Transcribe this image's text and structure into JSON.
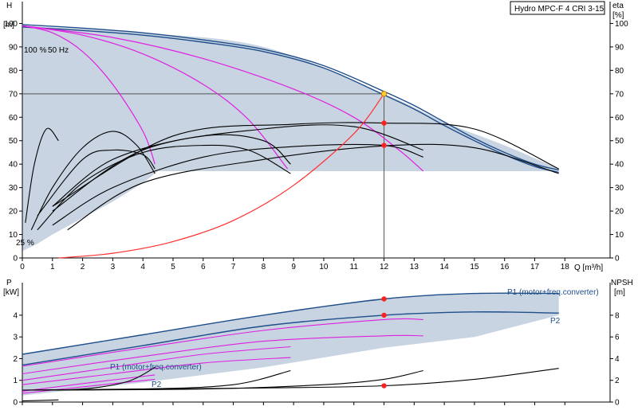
{
  "title": "Hydro MPC-F 4 CRI 3-15",
  "colors": {
    "envelope": "#c8d4e2",
    "curve_blue": "#1f4e8a",
    "curve_magenta": "#e020e0",
    "curve_black": "#000000",
    "system_curve": "#ff3030",
    "duty_point": "#ff2020",
    "duty_point_top": "#ffcc33",
    "grid_line": "#555555"
  },
  "top": {
    "y_left_label": "H",
    "y_left_unit": "[m]",
    "y_right_label": "eta",
    "y_right_unit": "[%]",
    "x_label": "Q [m³/h]",
    "annotation_speed": "100 %",
    "annotation_freq": "50 Hz",
    "annotation_min": "25 %"
  },
  "bottom": {
    "y_left_label": "P",
    "y_left_unit": "[kW]",
    "y_right_label": "NPSH",
    "y_right_unit": "[m]",
    "label_p1_upper": "P1 (motor+freq.converter)",
    "label_p2_upper": "P2",
    "label_p1_lower": "P1 (motor+freq.converter)",
    "label_p2_lower": "P2"
  },
  "chart_data": [
    {
      "type": "line",
      "title": "Hydro MPC-F 4 CRI 3-15",
      "xlabel": "Q [m³/h]",
      "ylabel": "H [m]",
      "y2label": "eta [%]",
      "xlim": [
        0,
        19.5
      ],
      "ylim": [
        0,
        110
      ],
      "xticks": [
        0,
        1,
        2,
        3,
        4,
        5,
        6,
        7,
        8,
        9,
        10,
        11,
        12,
        13,
        14,
        15,
        16,
        17,
        18
      ],
      "yticks": [
        0,
        10,
        20,
        30,
        40,
        50,
        60,
        70,
        80,
        90,
        100
      ],
      "grid": false,
      "envelope": {
        "upper": [
          [
            0,
            99
          ],
          [
            4,
            96
          ],
          [
            8,
            90
          ],
          [
            12,
            70
          ],
          [
            14,
            58
          ],
          [
            16,
            48
          ],
          [
            17.8,
            38
          ]
        ],
        "lower_x_from": 4.5,
        "lower_y": 37,
        "left_min_curve": [
          [
            0,
            3
          ],
          [
            0.5,
            6
          ],
          [
            1,
            10
          ],
          [
            2,
            17
          ],
          [
            3,
            24
          ],
          [
            4,
            32
          ],
          [
            4.5,
            37
          ]
        ]
      },
      "series": [
        {
          "kind": "head",
          "color": "blue",
          "values": [
            [
              0,
              99.5
            ],
            [
              2,
              98
            ],
            [
              4,
              96
            ],
            [
              6,
              93
            ],
            [
              8,
              89
            ],
            [
              10,
              82
            ],
            [
              12,
              71
            ],
            [
              13,
              65
            ],
            [
              14,
              58
            ],
            [
              15,
              51
            ],
            [
              16,
              45
            ],
            [
              17,
              40
            ],
            [
              17.8,
              37.5
            ]
          ]
        },
        {
          "kind": "head",
          "color": "blue",
          "values": [
            [
              0,
              98.5
            ],
            [
              2,
              97
            ],
            [
              4,
              95
            ],
            [
              6,
              92
            ],
            [
              8,
              88
            ],
            [
              10,
              81
            ],
            [
              12,
              69.5
            ],
            [
              13,
              63.5
            ],
            [
              14,
              56.5
            ],
            [
              15,
              50
            ],
            [
              16,
              44
            ],
            [
              17,
              39
            ],
            [
              17.8,
              36.5
            ]
          ]
        },
        {
          "kind": "head",
          "color": "magenta",
          "values": [
            [
              0,
              99
            ],
            [
              1,
              96
            ],
            [
              2,
              88
            ],
            [
              3,
              74
            ],
            [
              4,
              54
            ],
            [
              4.4,
              40
            ]
          ]
        },
        {
          "kind": "head",
          "color": "magenta",
          "values": [
            [
              0,
              99
            ],
            [
              2,
              95
            ],
            [
              4,
              87
            ],
            [
              6,
              74
            ],
            [
              7.5,
              59
            ],
            [
              8.8,
              38
            ]
          ]
        },
        {
          "kind": "head",
          "color": "magenta",
          "values": [
            [
              0,
              99
            ],
            [
              3,
              94
            ],
            [
              6,
              85
            ],
            [
              9,
              72
            ],
            [
              11,
              60
            ],
            [
              12.5,
              46
            ],
            [
              13.3,
              37
            ]
          ]
        },
        {
          "kind": "efficiency",
          "color": "black",
          "values": [
            [
              0.1,
              15
            ],
            [
              0.4,
              40
            ],
            [
              0.8,
              55
            ],
            [
              1.2,
              50
            ]
          ]
        },
        {
          "kind": "efficiency",
          "color": "black",
          "values": [
            [
              0.3,
              12
            ],
            [
              1,
              30
            ],
            [
              2,
              47
            ],
            [
              3,
              54
            ],
            [
              3.8,
              48
            ],
            [
              4.4,
              36
            ]
          ]
        },
        {
          "kind": "efficiency",
          "color": "black",
          "values": [
            [
              0.5,
              12
            ],
            [
              2,
              32
            ],
            [
              4,
              45
            ],
            [
              6,
              48
            ],
            [
              7.5,
              46
            ],
            [
              8.9,
              36
            ]
          ]
        },
        {
          "kind": "efficiency",
          "color": "black",
          "values": [
            [
              1,
              14
            ],
            [
              3,
              30
            ],
            [
              6,
              43
            ],
            [
              9,
              47.5
            ],
            [
              12,
              48
            ],
            [
              13.3,
              43
            ]
          ]
        },
        {
          "kind": "efficiency",
          "color": "black",
          "values": [
            [
              1.5,
              12
            ],
            [
              4,
              32
            ],
            [
              8,
              42
            ],
            [
              12,
              47.8
            ],
            [
              15,
              47
            ],
            [
              17.8,
              36
            ]
          ]
        },
        {
          "kind": "efficiency",
          "color": "black",
          "values": [
            [
              0.5,
              18
            ],
            [
              2,
              42
            ],
            [
              3,
              46
            ],
            [
              4,
              44
            ],
            [
              4.4,
              38
            ]
          ]
        },
        {
          "kind": "efficiency",
          "color": "black",
          "values": [
            [
              1,
              22
            ],
            [
              3,
              42
            ],
            [
              6,
              52
            ],
            [
              8,
              50
            ],
            [
              8.9,
              40
            ]
          ]
        },
        {
          "kind": "efficiency",
          "color": "black",
          "values": [
            [
              1,
              20
            ],
            [
              4,
              46
            ],
            [
              8,
              55
            ],
            [
              11,
              56
            ],
            [
              13.3,
              46
            ]
          ]
        },
        {
          "kind": "efficiency",
          "color": "black",
          "values": [
            [
              1,
              22
            ],
            [
              5,
              52
            ],
            [
              9,
              57
            ],
            [
              12,
              57.5
            ],
            [
              15,
              55
            ],
            [
              17.8,
              38
            ]
          ]
        },
        {
          "kind": "system",
          "color": "red",
          "values": [
            [
              1.2,
              0
            ],
            [
              3,
              2
            ],
            [
              5,
              7
            ],
            [
              7,
              16
            ],
            [
              9,
              31
            ],
            [
              11,
              53
            ],
            [
              12,
              70
            ]
          ]
        }
      ],
      "duty_points": [
        {
          "x": 12,
          "y": 70,
          "kind": "head"
        },
        {
          "x": 12,
          "y": 57.5,
          "kind": "eta_total"
        },
        {
          "x": 12,
          "y": 48,
          "kind": "eta"
        }
      ]
    },
    {
      "type": "line",
      "xlabel": "Q [m³/h]",
      "ylabel": "P [kW]",
      "y2label": "NPSH [m]",
      "xlim": [
        0,
        19.5
      ],
      "ylim": [
        0,
        5.5
      ],
      "yticks": [
        0,
        1,
        2,
        3,
        4
      ],
      "y2ticks": [
        0,
        2,
        4,
        6,
        8
      ],
      "series": [
        {
          "name": "P1 (motor+freq.converter)",
          "kind": "power",
          "color": "blue",
          "values": [
            [
              0,
              2.2
            ],
            [
              4,
              3.1
            ],
            [
              8,
              4.0
            ],
            [
              12,
              4.75
            ],
            [
              15,
              5.0
            ],
            [
              17.8,
              5.0
            ]
          ]
        },
        {
          "name": "P2",
          "kind": "power",
          "color": "blue",
          "values": [
            [
              0,
              1.7
            ],
            [
              4,
              2.6
            ],
            [
              8,
              3.5
            ],
            [
              12,
              4.0
            ],
            [
              15,
              4.15
            ],
            [
              17.8,
              4.1
            ]
          ]
        },
        {
          "kind": "power",
          "color": "magenta",
          "values": [
            [
              0,
              1.65
            ],
            [
              4,
              2.5
            ],
            [
              8,
              3.3
            ],
            [
              12,
              3.8
            ],
            [
              13.3,
              3.8
            ]
          ]
        },
        {
          "kind": "power",
          "color": "magenta",
          "values": [
            [
              0,
              1.3
            ],
            [
              4,
              2.1
            ],
            [
              8,
              2.8
            ],
            [
              12,
              3.05
            ],
            [
              13.3,
              3.05
            ]
          ]
        },
        {
          "kind": "power",
          "color": "magenta",
          "values": [
            [
              0,
              1.0
            ],
            [
              3,
              1.6
            ],
            [
              6,
              2.2
            ],
            [
              8.9,
              2.55
            ]
          ]
        },
        {
          "kind": "power",
          "color": "magenta",
          "values": [
            [
              0,
              0.8
            ],
            [
              3,
              1.3
            ],
            [
              6,
              1.8
            ],
            [
              8.9,
              2.05
            ]
          ]
        },
        {
          "kind": "power",
          "color": "magenta",
          "values": [
            [
              0,
              0.5
            ],
            [
              2,
              0.85
            ],
            [
              4.4,
              1.25
            ]
          ]
        },
        {
          "kind": "power",
          "color": "magenta",
          "values": [
            [
              0,
              0.4
            ],
            [
              2,
              0.7
            ],
            [
              4.4,
              1.05
            ]
          ]
        },
        {
          "kind": "npsh",
          "color": "black",
          "values": [
            [
              0,
              0.55
            ],
            [
              4,
              0.6
            ],
            [
              8,
              0.65
            ],
            [
              12,
              0.75
            ],
            [
              15,
              1.05
            ],
            [
              17.8,
              1.55
            ]
          ]
        },
        {
          "kind": "npsh",
          "color": "black",
          "values": [
            [
              0,
              0.55
            ],
            [
              6,
              0.6
            ],
            [
              10,
              0.8
            ],
            [
              12,
              1.05
            ],
            [
              13.3,
              1.45
            ]
          ]
        },
        {
          "kind": "npsh",
          "color": "black",
          "values": [
            [
              0,
              0.55
            ],
            [
              4,
              0.6
            ],
            [
              7,
              0.8
            ],
            [
              8.9,
              1.45
            ]
          ]
        },
        {
          "kind": "npsh",
          "color": "black",
          "values": [
            [
              0,
              0.55
            ],
            [
              2,
              0.6
            ],
            [
              3.5,
              0.95
            ],
            [
              4.4,
              1.6
            ]
          ]
        },
        {
          "kind": "npsh",
          "color": "black",
          "values": [
            [
              0,
              0.05
            ],
            [
              1.2,
              0.1
            ]
          ]
        }
      ],
      "duty_points": [
        {
          "x": 12,
          "y": 4.75
        },
        {
          "x": 12,
          "y": 4.0
        },
        {
          "x": 12,
          "y": 0.75
        }
      ]
    }
  ]
}
